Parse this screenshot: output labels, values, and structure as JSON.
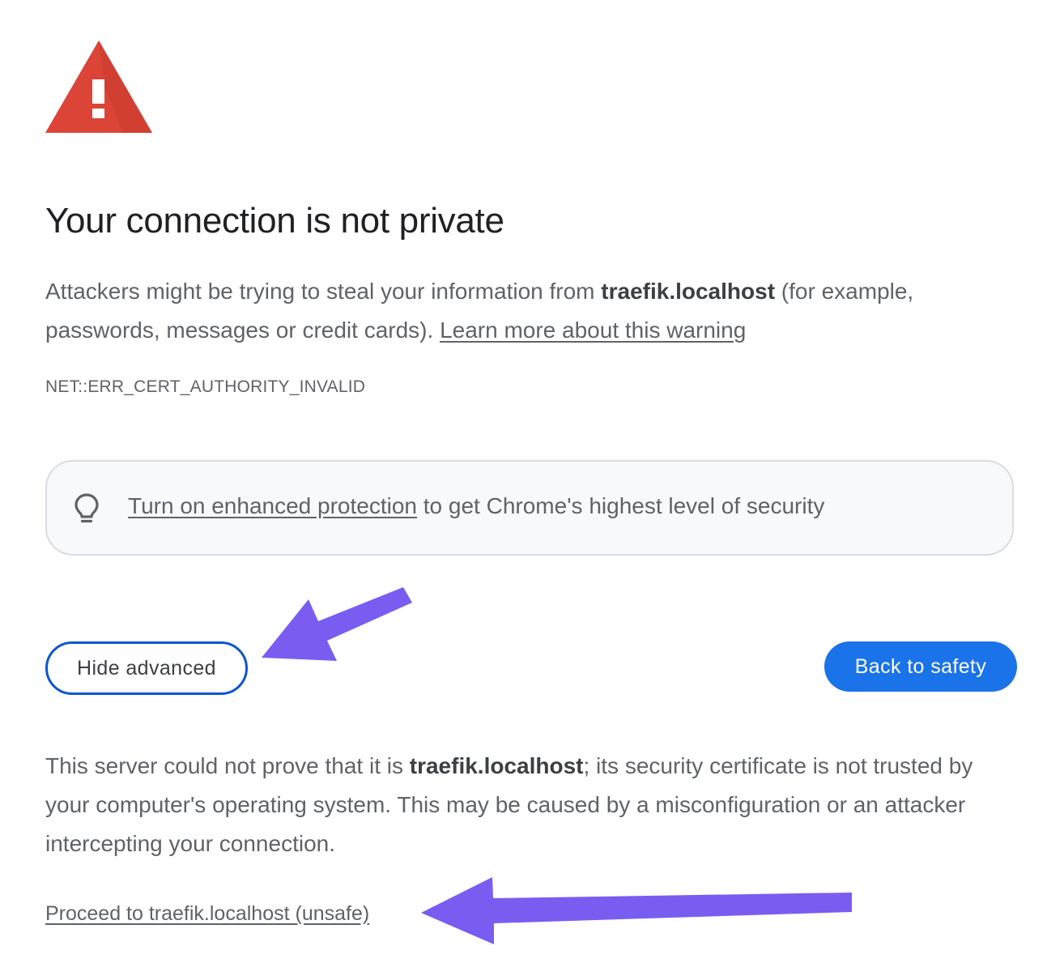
{
  "colors": {
    "warning_red": "#db4437",
    "primary_blue": "#1a73e8",
    "outline_blue": "#0b57d0",
    "annotation_purple": "#7b5cf0",
    "text_gray": "#5f6368",
    "heading": "#202124"
  },
  "icons": {
    "warning": "warning-triangle-icon",
    "bulb": "lightbulb-icon"
  },
  "heading": "Your connection is not private",
  "intro": {
    "prefix": "Attackers might be trying to steal your information from ",
    "host": "traefik.localhost",
    "suffix": " (for example, passwords, messages or credit cards). ",
    "learn_more": "Learn more about this warning"
  },
  "error_code": "NET::ERR_CERT_AUTHORITY_INVALID",
  "enhanced": {
    "link": "Turn on enhanced protection",
    "text": " to get Chrome's highest level of security"
  },
  "buttons": {
    "hide_advanced": "Hide advanced",
    "back_to_safety": "Back to safety"
  },
  "details": {
    "prefix": "This server could not prove that it is ",
    "host": "traefik.localhost",
    "suffix": "; its security certificate is not trusted by your computer's operating system. This may be caused by a misconfiguration or an attacker intercepting your connection."
  },
  "proceed_link": "Proceed to traefik.localhost (unsafe)"
}
